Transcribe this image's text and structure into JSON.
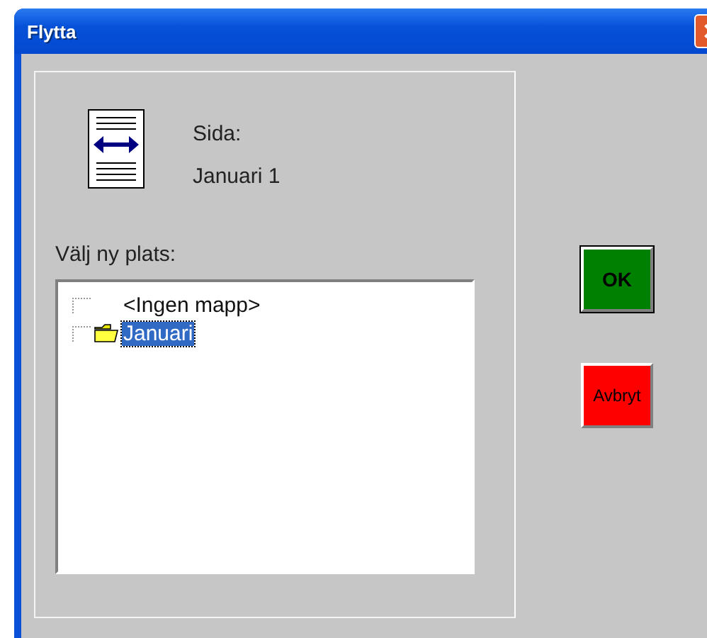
{
  "window": {
    "title": "Flytta"
  },
  "page": {
    "label": "Sida:",
    "name": "Januari 1"
  },
  "location": {
    "label": "Välj ny plats:",
    "tree": [
      {
        "label": "<Ingen mapp>",
        "kind": "none",
        "selected": false
      },
      {
        "label": "Januari",
        "kind": "folder",
        "selected": true
      }
    ]
  },
  "buttons": [
    {
      "label": "OK",
      "kind": "ok",
      "default": true
    },
    {
      "label": "Avbryt",
      "kind": "cancel",
      "default": false
    }
  ]
}
